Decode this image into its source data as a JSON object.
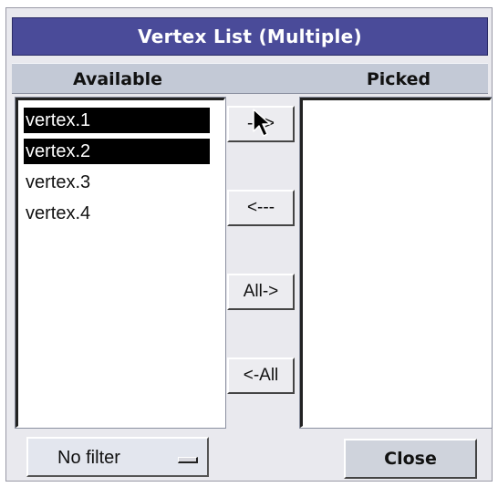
{
  "window": {
    "title": "Vertex List (Multiple)"
  },
  "columns": {
    "available": "Available",
    "picked": "Picked"
  },
  "available_items": [
    {
      "label": "vertex.1",
      "selected": true
    },
    {
      "label": "vertex.2",
      "selected": true
    },
    {
      "label": "vertex.3",
      "selected": false
    },
    {
      "label": "vertex.4",
      "selected": false
    }
  ],
  "picked_items": [],
  "buttons": {
    "move_right": "--->",
    "move_left": "<---",
    "move_all_right": "All->",
    "move_all_left": "<-All",
    "close": "Close"
  },
  "filter": {
    "selected": "No filter"
  },
  "colors": {
    "titlebar": "#4a4b99",
    "selection": "#000000",
    "header": "#c3c9d6"
  },
  "icons": {
    "cursor": "arrow-pointer-icon",
    "filter_indicator": "option-menu-indicator-icon"
  }
}
